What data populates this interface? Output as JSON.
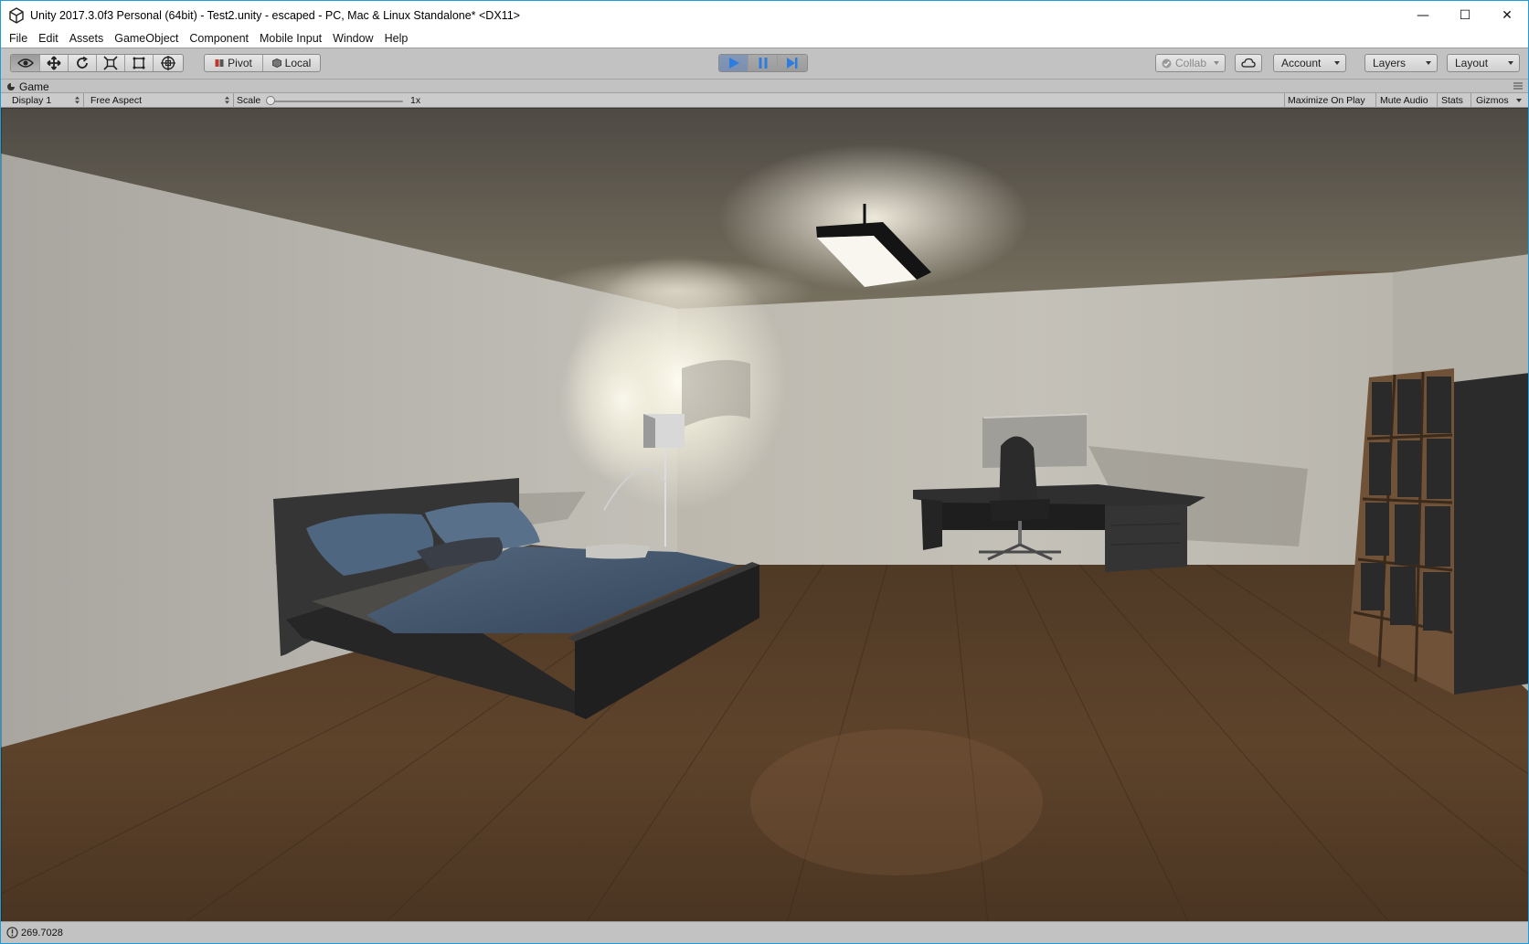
{
  "window": {
    "title": "Unity 2017.3.0f3 Personal (64bit) - Test2.unity - escaped - PC, Mac & Linux Standalone* <DX11>",
    "controls": {
      "minimize": "—",
      "maximize": "☐",
      "close": "✕"
    }
  },
  "menubar": {
    "items": [
      "File",
      "Edit",
      "Assets",
      "GameObject",
      "Component",
      "Mobile Input",
      "Window",
      "Help"
    ]
  },
  "toolbar": {
    "transform_tools": [
      "hand-tool",
      "move-tool",
      "rotate-tool",
      "scale-tool",
      "rect-tool",
      "transform-tool"
    ],
    "active_tool": "hand-tool",
    "pivot_label": "Pivot",
    "local_label": "Local",
    "play_state": "playing",
    "collab_label": "Collab",
    "account_label": "Account",
    "layers_label": "Layers",
    "layout_label": "Layout"
  },
  "game_view": {
    "tab_label": "Game",
    "display_label": "Display 1",
    "aspect_label": "Free Aspect",
    "scale_label": "Scale",
    "scale_value_label": "1x",
    "scale_value": 1,
    "maximize_label": "Maximize On Play",
    "mute_label": "Mute Audio",
    "stats_label": "Stats",
    "gizmos_label": "Gizmos"
  },
  "scene": {
    "objects": [
      "ceiling-lamp",
      "floor-lamp",
      "bed",
      "pillows",
      "desk",
      "monitor",
      "office-chair",
      "bookshelf",
      "wooden-floor"
    ],
    "colors": {
      "ceiling": "#6a6358",
      "wall": "#bdbab2",
      "floor": "#5a3e27",
      "bedding": "#3e5066",
      "furniture": "#2c2c2c"
    }
  },
  "status": {
    "message": "269.7028"
  },
  "colors": {
    "accent": "#1e9bd8",
    "play_active": "#7b8fb0",
    "editor_bg": "#c2c2c2"
  }
}
